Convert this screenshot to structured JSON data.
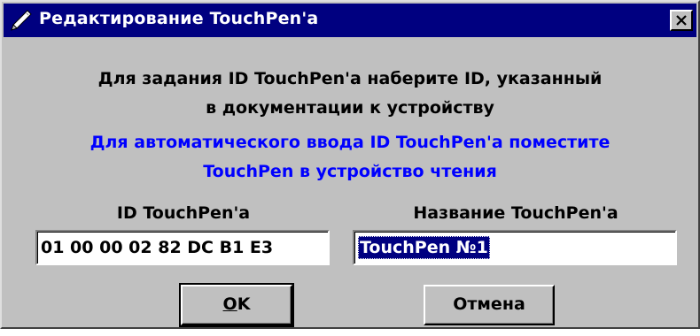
{
  "window": {
    "title": "Редактирование TouchPen'a",
    "icon": "pen-icon",
    "close_icon": "close-icon"
  },
  "messages": {
    "instruction_line1": "Для задания ID TouchPen'a наберите ID, указанный",
    "instruction_line2": "в документации к устройству",
    "auto_line1": "Для автоматического ввода ID TouchPen'a поместите",
    "auto_line2": "TouchPen в устройство чтения"
  },
  "fields": {
    "id_label": "ID TouchPen'a",
    "id_value": "01 00 00 02 82 DC B1 E3",
    "name_label": "Название TouchPen'a",
    "name_value": "TouchPen №1"
  },
  "buttons": {
    "ok_mnemonic": "O",
    "ok_rest": "K",
    "cancel_label": "Отмена"
  },
  "colors": {
    "titlebar": "#000080",
    "dialog_bg": "#c0c0c0",
    "info_text": "#0000ff",
    "selection": "#000080"
  }
}
